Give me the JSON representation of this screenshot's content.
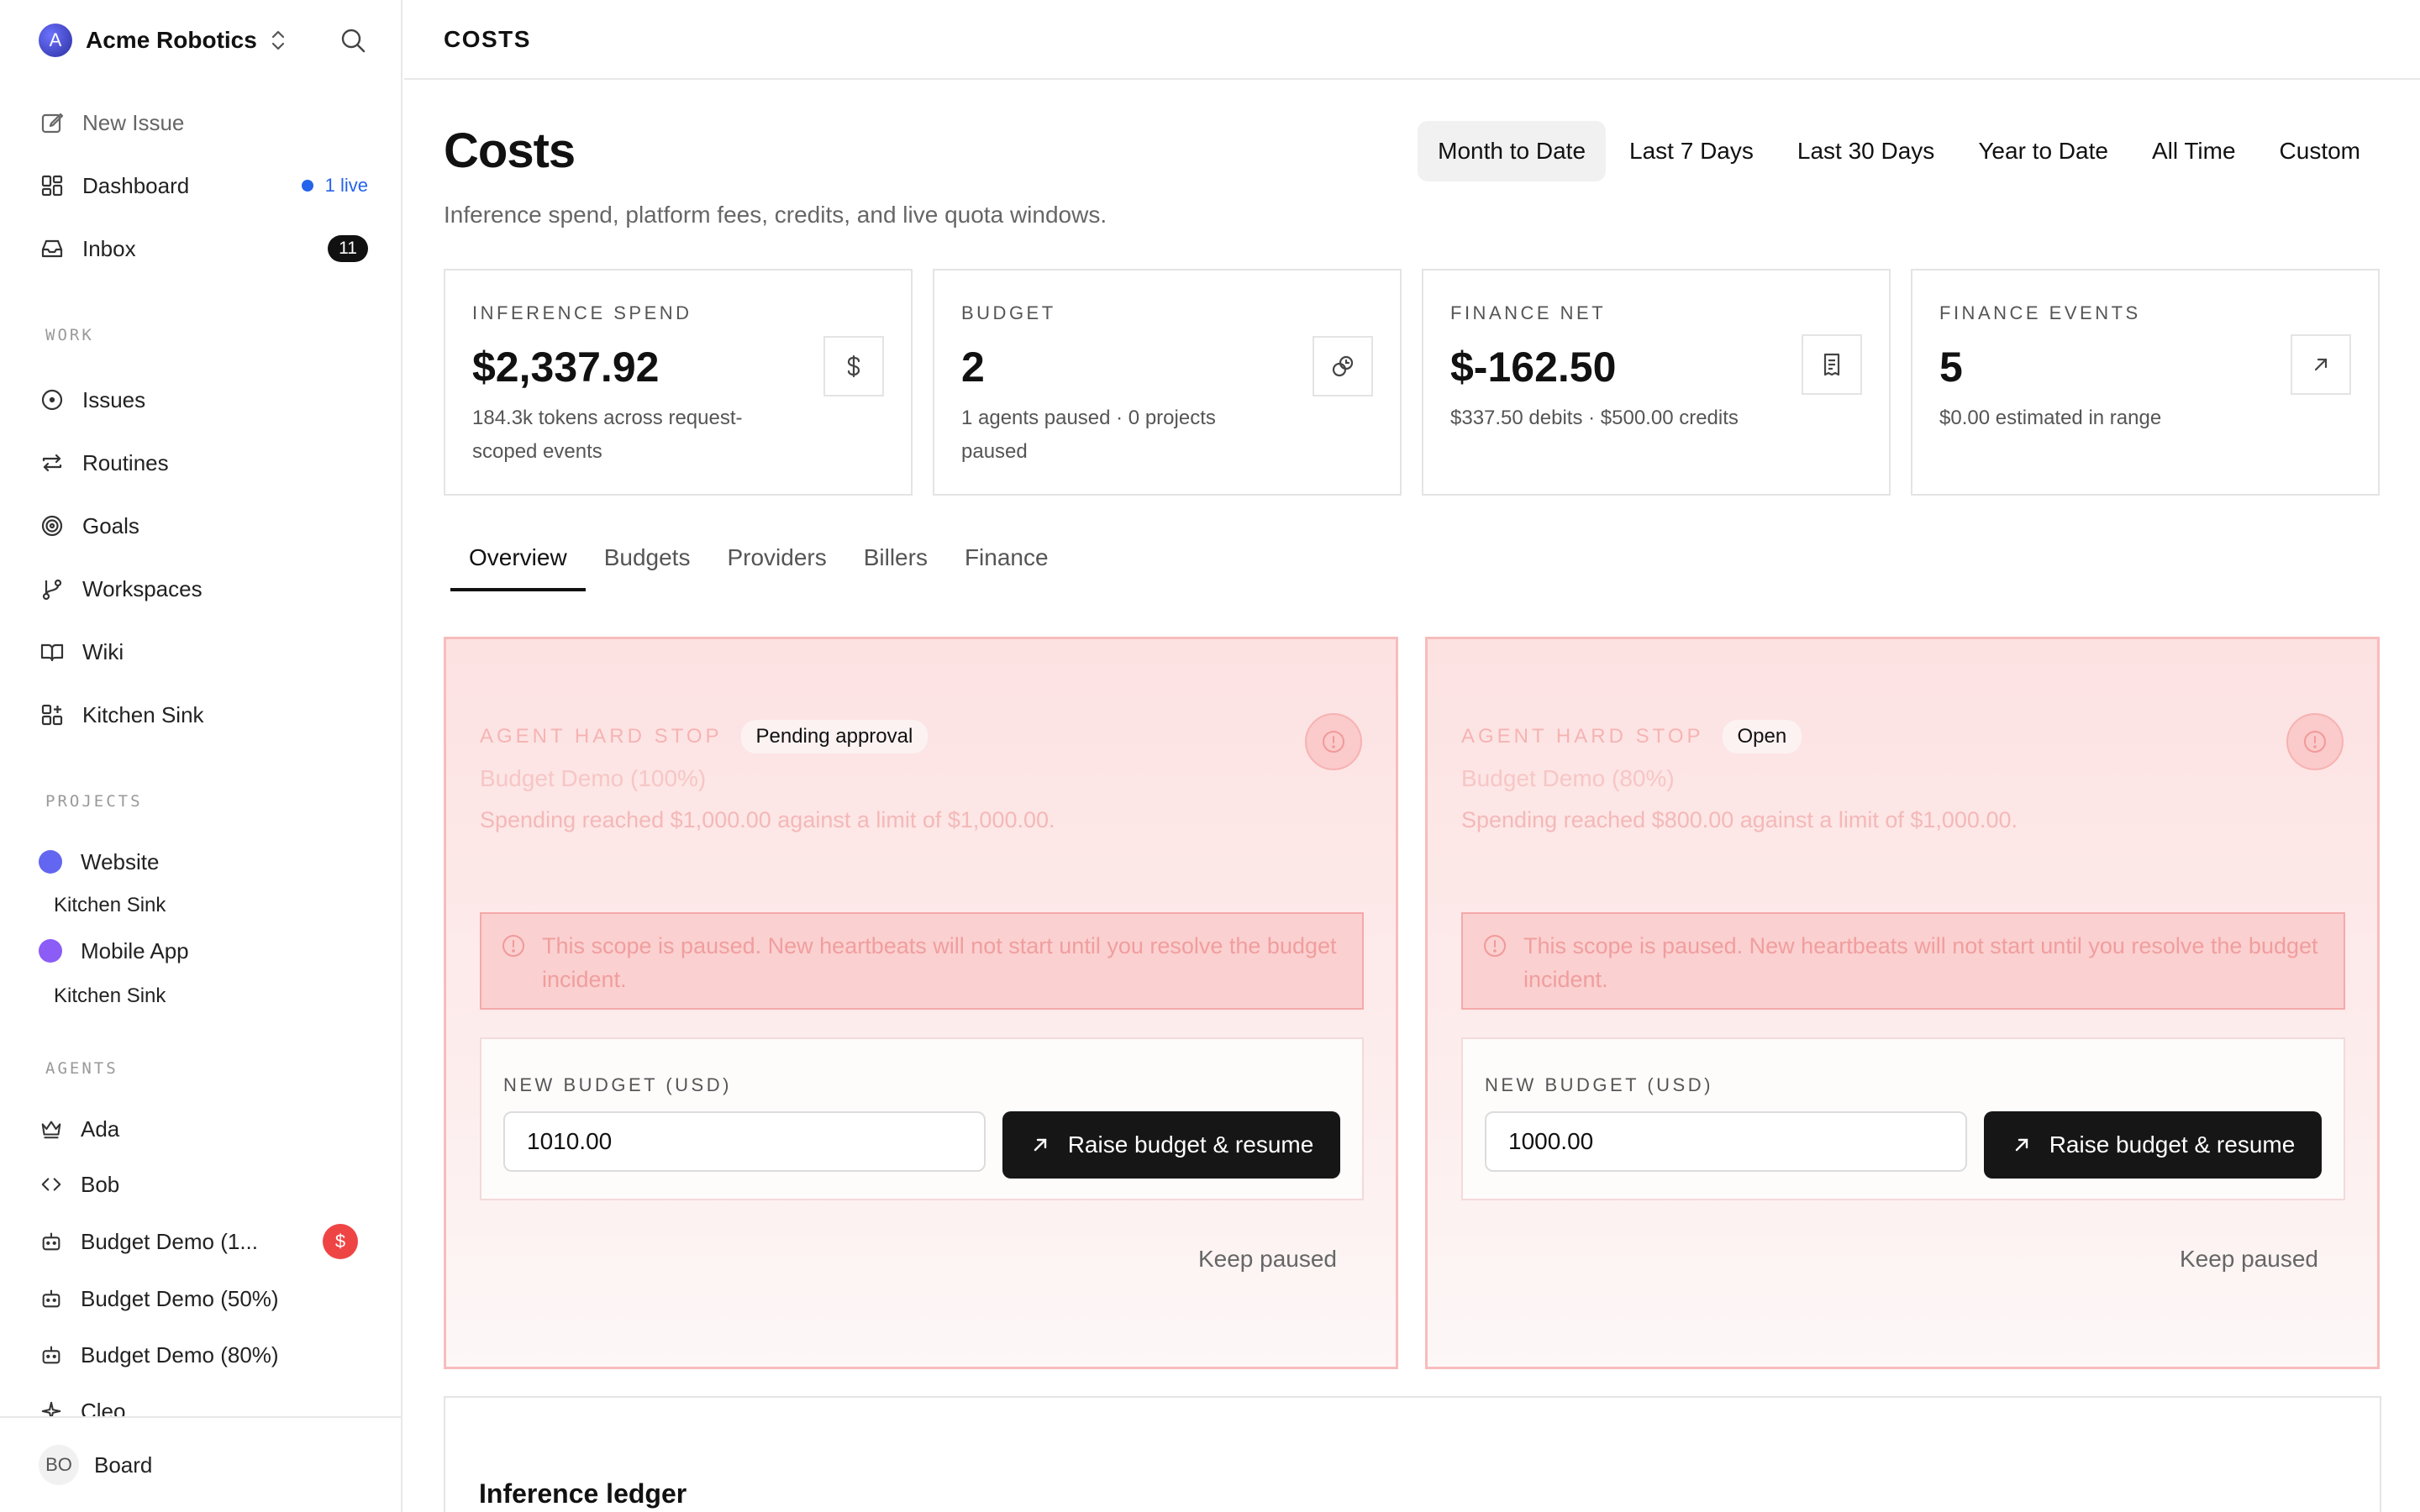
{
  "workspace": {
    "name": "Acme Robotics",
    "logo_letter": "A"
  },
  "nav": {
    "new_issue": "New Issue",
    "dashboard": "Dashboard",
    "dashboard_live": "1 live",
    "inbox": "Inbox",
    "inbox_count": "11"
  },
  "sections": {
    "work": "WORK",
    "projects": "PROJECTS",
    "agents": "AGENTS"
  },
  "work_items": [
    "Issues",
    "Routines",
    "Goals",
    "Workspaces",
    "Wiki",
    "Kitchen Sink"
  ],
  "projects": [
    {
      "name": "Website",
      "color": "#6366f1",
      "sub": "Kitchen Sink"
    },
    {
      "name": "Mobile App",
      "color": "#8b5cf6",
      "sub": "Kitchen Sink"
    }
  ],
  "agents": [
    "Ada",
    "Bob",
    "Budget Demo (1...",
    "Budget Demo (50%)",
    "Budget Demo (80%)",
    "Cleo"
  ],
  "agent_alert_symbol": "$",
  "footer": {
    "initials": "BO",
    "name": "Board"
  },
  "header": {
    "breadcrumb": "COSTS"
  },
  "page": {
    "title": "Costs",
    "subtitle": "Inference spend, platform fees, credits, and live quota windows."
  },
  "range_tabs": [
    "Month to Date",
    "Last 7 Days",
    "Last 30 Days",
    "Year to Date",
    "All Time",
    "Custom"
  ],
  "range_active": "Month to Date",
  "stats": [
    {
      "label": "INFERENCE SPEND",
      "value": "$2,337.92",
      "note": "184.3k tokens across request-scoped events",
      "icon": "dollar-icon"
    },
    {
      "label": "BUDGET",
      "value": "2",
      "note": "1 agents paused · 0 projects paused",
      "icon": "link-icon"
    },
    {
      "label": "FINANCE NET",
      "value": "$-162.50",
      "note": "$337.50 debits · $500.00 credits",
      "icon": "receipt-icon"
    },
    {
      "label": "FINANCE EVENTS",
      "value": "5",
      "note": "$0.00 estimated in range",
      "icon": "arrow-up-right-icon"
    }
  ],
  "sub_tabs": [
    "Overview",
    "Budgets",
    "Providers",
    "Billers",
    "Finance"
  ],
  "sub_tab_active": "Overview",
  "incidents": [
    {
      "kicker": "AGENT HARD STOP",
      "status": "Pending approval",
      "title": "Budget Demo (100%)",
      "description": "Spending reached $1,000.00 against a limit of $1,000.00.",
      "banner": "This scope is paused. New heartbeats will not start until you resolve the budget incident.",
      "budget_label": "NEW BUDGET (USD)",
      "budget_value": "1010.00",
      "raise_label": "Raise budget & resume",
      "keep_label": "Keep paused"
    },
    {
      "kicker": "AGENT HARD STOP",
      "status": "Open",
      "title": "Budget Demo (80%)",
      "description": "Spending reached $800.00 against a limit of $1,000.00.",
      "banner": "This scope is paused. New heartbeats will not start until you resolve the budget incident.",
      "budget_label": "NEW BUDGET (USD)",
      "budget_value": "1000.00",
      "raise_label": "Raise budget & resume",
      "keep_label": "Keep paused"
    }
  ],
  "ledger": {
    "title": "Inference ledger"
  },
  "colors": {
    "accent_blue": "#2563eb",
    "alert_red": "#ef4444",
    "incident_bg": "#fde2e2",
    "primary_button": "#161616"
  }
}
